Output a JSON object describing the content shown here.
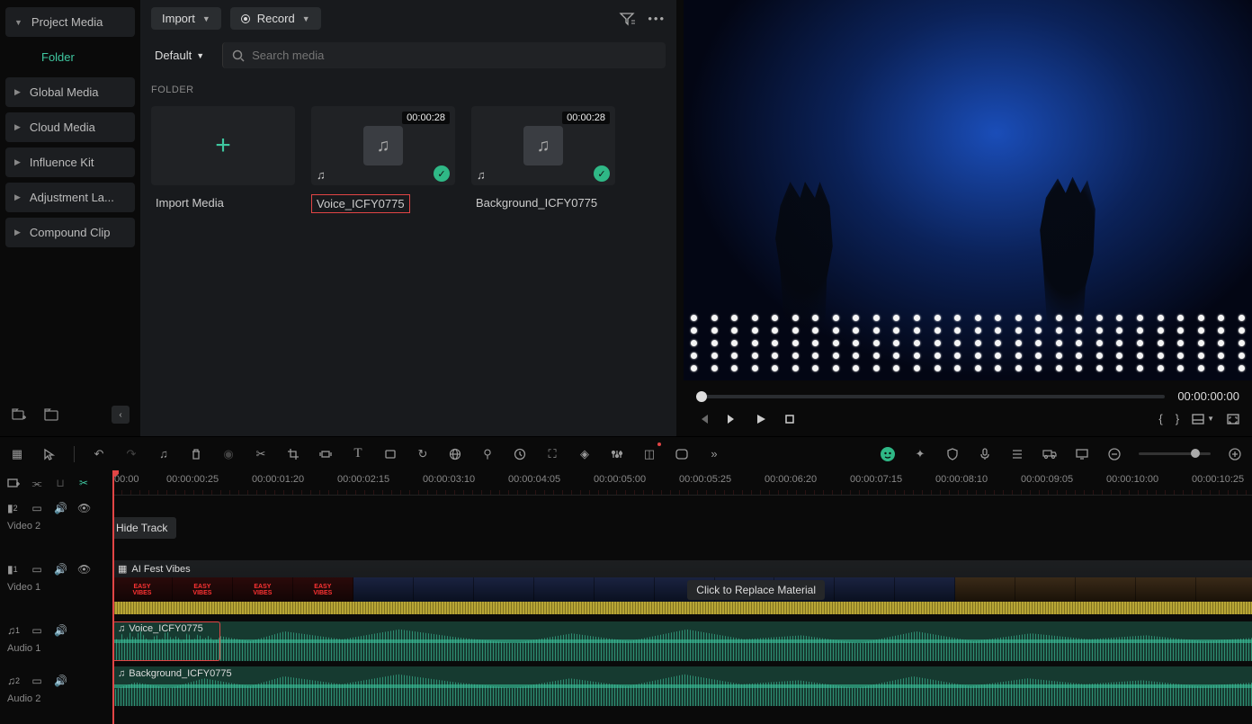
{
  "sidebar": {
    "items": [
      {
        "label": "Project Media"
      },
      {
        "label": "Folder"
      },
      {
        "label": "Global Media"
      },
      {
        "label": "Cloud Media"
      },
      {
        "label": "Influence Kit"
      },
      {
        "label": "Adjustment La..."
      },
      {
        "label": "Compound Clip"
      }
    ]
  },
  "media_panel": {
    "import_label": "Import",
    "record_label": "Record",
    "sort_label": "Default",
    "search_placeholder": "Search media",
    "folder_heading": "FOLDER",
    "cards": [
      {
        "title": "Import Media"
      },
      {
        "title": "Voice_ICFY0775",
        "duration": "00:00:28"
      },
      {
        "title": "Background_ICFY0775",
        "duration": "00:00:28"
      }
    ]
  },
  "preview": {
    "time": "00:00:00:00"
  },
  "timeline": {
    "ruler": [
      "00:00",
      "00:00:00:25",
      "00:00:01:20",
      "00:00:02:15",
      "00:00:03:10",
      "00:00:04:05",
      "00:00:05:00",
      "00:00:05:25",
      "00:00:06:20",
      "00:00:07:15",
      "00:00:08:10",
      "00:00:09:05",
      "00:00:10:00",
      "00:00:10:25"
    ],
    "tracks": {
      "video2": {
        "badge": "2",
        "label": "Video 2"
      },
      "video1": {
        "badge": "1",
        "label": "Video 1",
        "clip_name": "AI Fest Vibes",
        "replace_tip": "Click to Replace Material"
      },
      "audio1": {
        "badge": "1",
        "label": "Audio 1",
        "clip_name": "Voice_ICFY0775"
      },
      "audio2": {
        "badge": "2",
        "label": "Audio 2",
        "clip_name": "Background_ICFY0775"
      }
    },
    "tooltip": "Hide Track"
  }
}
